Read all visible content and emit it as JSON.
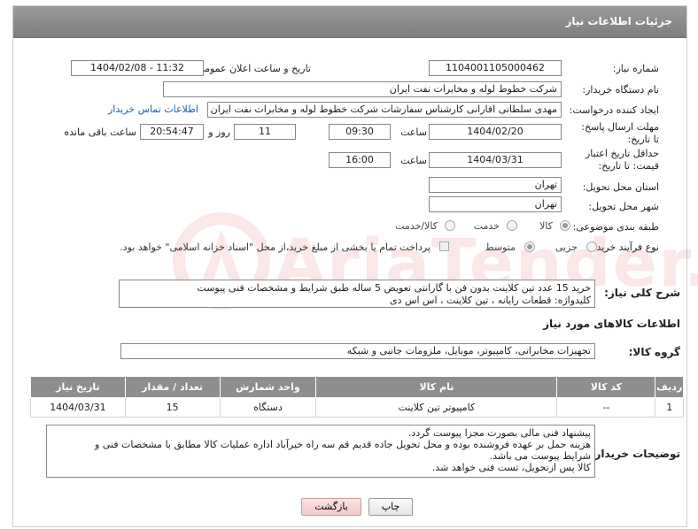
{
  "header": {
    "title": "جزئیات اطلاعات نیاز"
  },
  "form": {
    "need_number_label": "شماره نیاز:",
    "need_number": "1104001105000462",
    "announce_label": "تاریخ و ساعت اعلان عمومی:",
    "announce_value": "1404/02/08 - 11:32",
    "buyer_org_label": "نام دستگاه خریدار:",
    "buyer_org": "شرکت خطوط لوله و مخابرات نفت ایران",
    "creator_label": "ایجاد کننده درخواست:",
    "creator": "مهدی سلطانی افارانی کارشناس سفارشات  شرکت خطوط لوله و مخابرات نفت ایران",
    "contact_link": "اطلاعات تماس خریدار",
    "deadline_label": "مهلت ارسال پاسخ: تا تاریخ:",
    "deadline_date": "1404/02/20",
    "time_label": "ساعت",
    "deadline_time": "09:30",
    "days_value": "11",
    "days_label": "روز و",
    "remaining_time": "20:54:47",
    "remaining_label": "ساعت باقی مانده",
    "price_valid_label": "حداقل تاریخ اعتبار قیمت: تا تاریخ:",
    "price_valid_date": "1404/03/31",
    "price_valid_time": "16:00",
    "province_label": "استان محل تحویل:",
    "province": "تهران",
    "city_label": "شهر محل تحویل:",
    "city": "تهران",
    "category_label": "طبقه بندی موضوعی:",
    "category_options": [
      "کالا",
      "خدمت",
      "کالا/خدمت"
    ],
    "process_label": "نوع فرآیند خرید :",
    "process_options": [
      "جزیی",
      "متوسط"
    ],
    "payment_note": "پرداخت تمام یا بخشی از مبلغ خرید،از محل \"اسناد خزانه اسلامی\" خواهد بود."
  },
  "description": {
    "label": "شرح کلی نیاز:",
    "line1": "خرید 15 عدد  تین کلاینت بدون فن با گارانتی تعویض 5 ساله طبق شرایط  و مشخصات فنی پیوست",
    "line2": "کلیدواژه: قطعات رایانه ،  تین کلاینت ،  اس اس دی"
  },
  "goods": {
    "section_title": "اطلاعات کالاهای مورد نیاز",
    "group_label": "گروه کالا:",
    "group_value": "تجهیزات مخابراتی، کامپیوتر، موبایل، ملزومات جانبی و شبکه",
    "columns": [
      "ردیف",
      "کد کالا",
      "نام کالا",
      "واحد شمارش",
      "تعداد / مقدار",
      "تاریخ نیاز"
    ],
    "rows": [
      {
        "row": "1",
        "code": "--",
        "name": "کامپیوتر تین کلاینت",
        "unit": "دستگاه",
        "qty": "15",
        "date": "1404/03/31"
      }
    ]
  },
  "buyer_notes": {
    "label": "توضیحات خریدار:",
    "line1": "پیشنهاد  فنی مالی بصورت مجزا پیوست گردد.",
    "line2": "هزینه حمل بر عهده فروشنده بوده و محل تحویل جاده قدیم قم سه راه خیرآباد اداره عملیات کالا مطابق با مشخصات فنی و",
    "line3": "شرایط پیوست می باشد.",
    "line4": "کالا پس ازتحویل، تست فنی خواهد شد."
  },
  "buttons": {
    "print": "چاپ",
    "back": "بازگشت"
  },
  "watermark": {
    "text": "AriaTender.neT"
  }
}
